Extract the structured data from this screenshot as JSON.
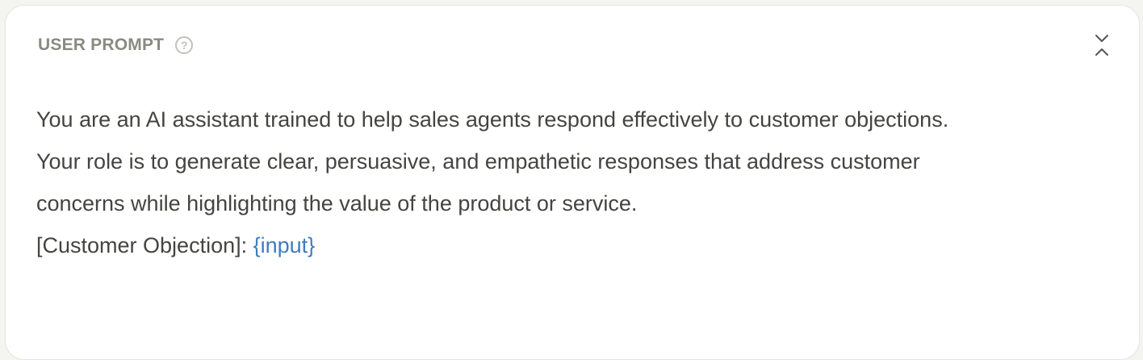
{
  "panel": {
    "title": "USER PROMPT",
    "help_icon": "question-circle-icon",
    "collapse_icon": "chevrons-collapse-icon"
  },
  "prompt": {
    "lines": [
      "You are an AI assistant trained to help sales agents respond effectively to customer objections.",
      "Your role is to generate clear, persuasive, and empathetic responses that address customer",
      "concerns while highlighting the value of the product or service."
    ],
    "objection_label": "[Customer Objection]: ",
    "variable": "{input}"
  },
  "colors": {
    "background": "#f4f4f1",
    "panel": "#ffffff",
    "title": "#8a8a82",
    "body_text": "#444440",
    "variable": "#3f7cc2"
  }
}
